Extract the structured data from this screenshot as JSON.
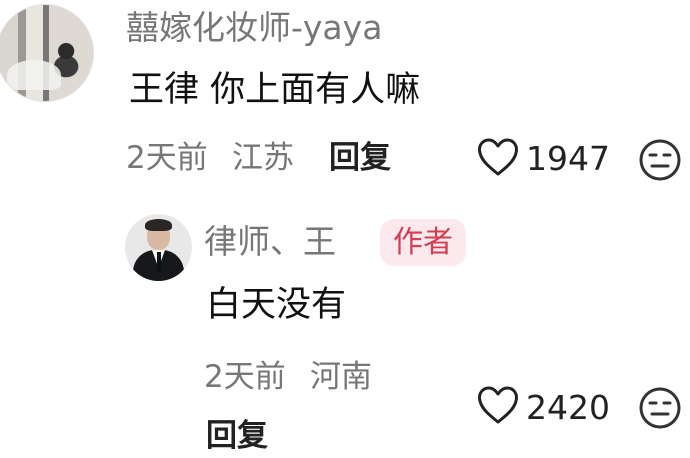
{
  "comments": [
    {
      "author": "囍嫁化妆师-yaya",
      "avatar_icon": "profile-photo-icon",
      "text": "王律 你上面有人嘛",
      "time": "2天前",
      "location": "江苏",
      "reply_label": "回复",
      "like_icon": "heart-outline-icon",
      "like_count": "1947",
      "dislike_icon": "neutral-face-icon"
    },
    {
      "author": "律师、王",
      "avatar_icon": "lawyer-profile-photo-icon",
      "author_badge": "作者",
      "text": "白天没有",
      "time": "2天前",
      "location": "河南",
      "reply_label": "回复",
      "like_icon": "heart-outline-icon",
      "like_count": "2420",
      "dislike_icon": "neutral-face-icon"
    }
  ],
  "colors": {
    "name_text": "#777777",
    "body_text": "#111111",
    "badge_background": "#FBE9ED",
    "badge_text": "#D43E54"
  }
}
